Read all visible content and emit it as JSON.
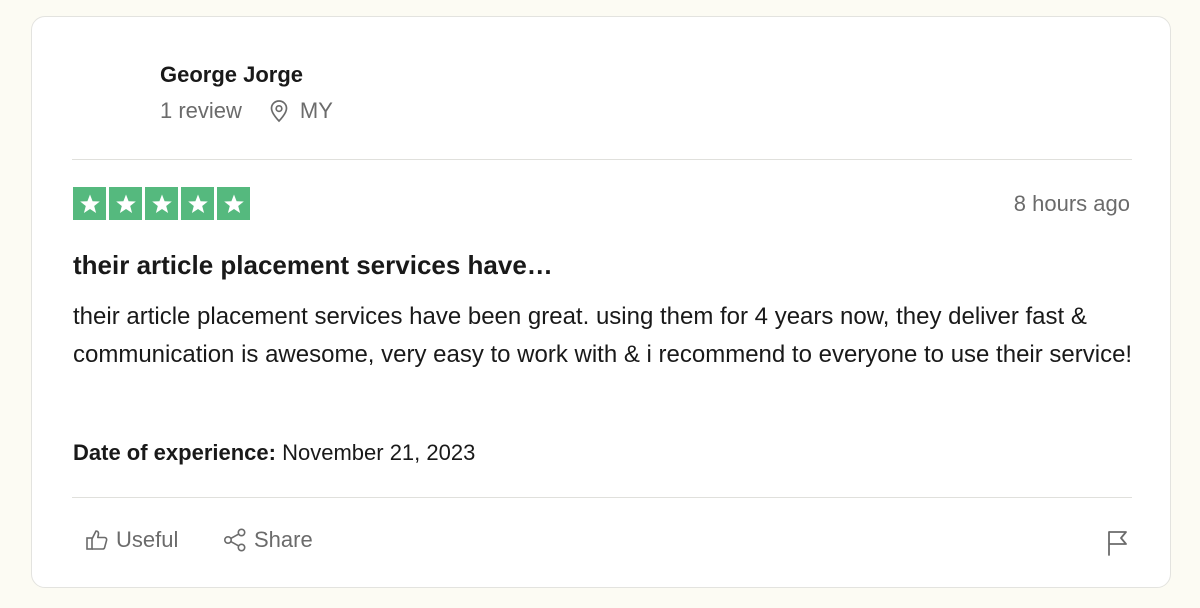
{
  "reviewer": {
    "name": "George Jorge",
    "review_count": "1 review",
    "location_icon": "location-pin-icon",
    "country": "MY"
  },
  "review": {
    "rating": 5,
    "rating_max": 5,
    "star_color": "#55b97e",
    "date": "8 hours ago",
    "title": "their article placement services have…",
    "body": "their article placement services have been great. using them for 4 years now, they deliver fast & communication is awesome, very easy to work with & i recommend to everyone to use their service!",
    "experience_label": "Date of experience:",
    "experience_date": "November 21, 2023"
  },
  "actions": {
    "useful_label": "Useful",
    "useful_icon": "thumbs-up-icon",
    "share_label": "Share",
    "share_icon": "share-icon",
    "report_icon": "flag-icon"
  }
}
